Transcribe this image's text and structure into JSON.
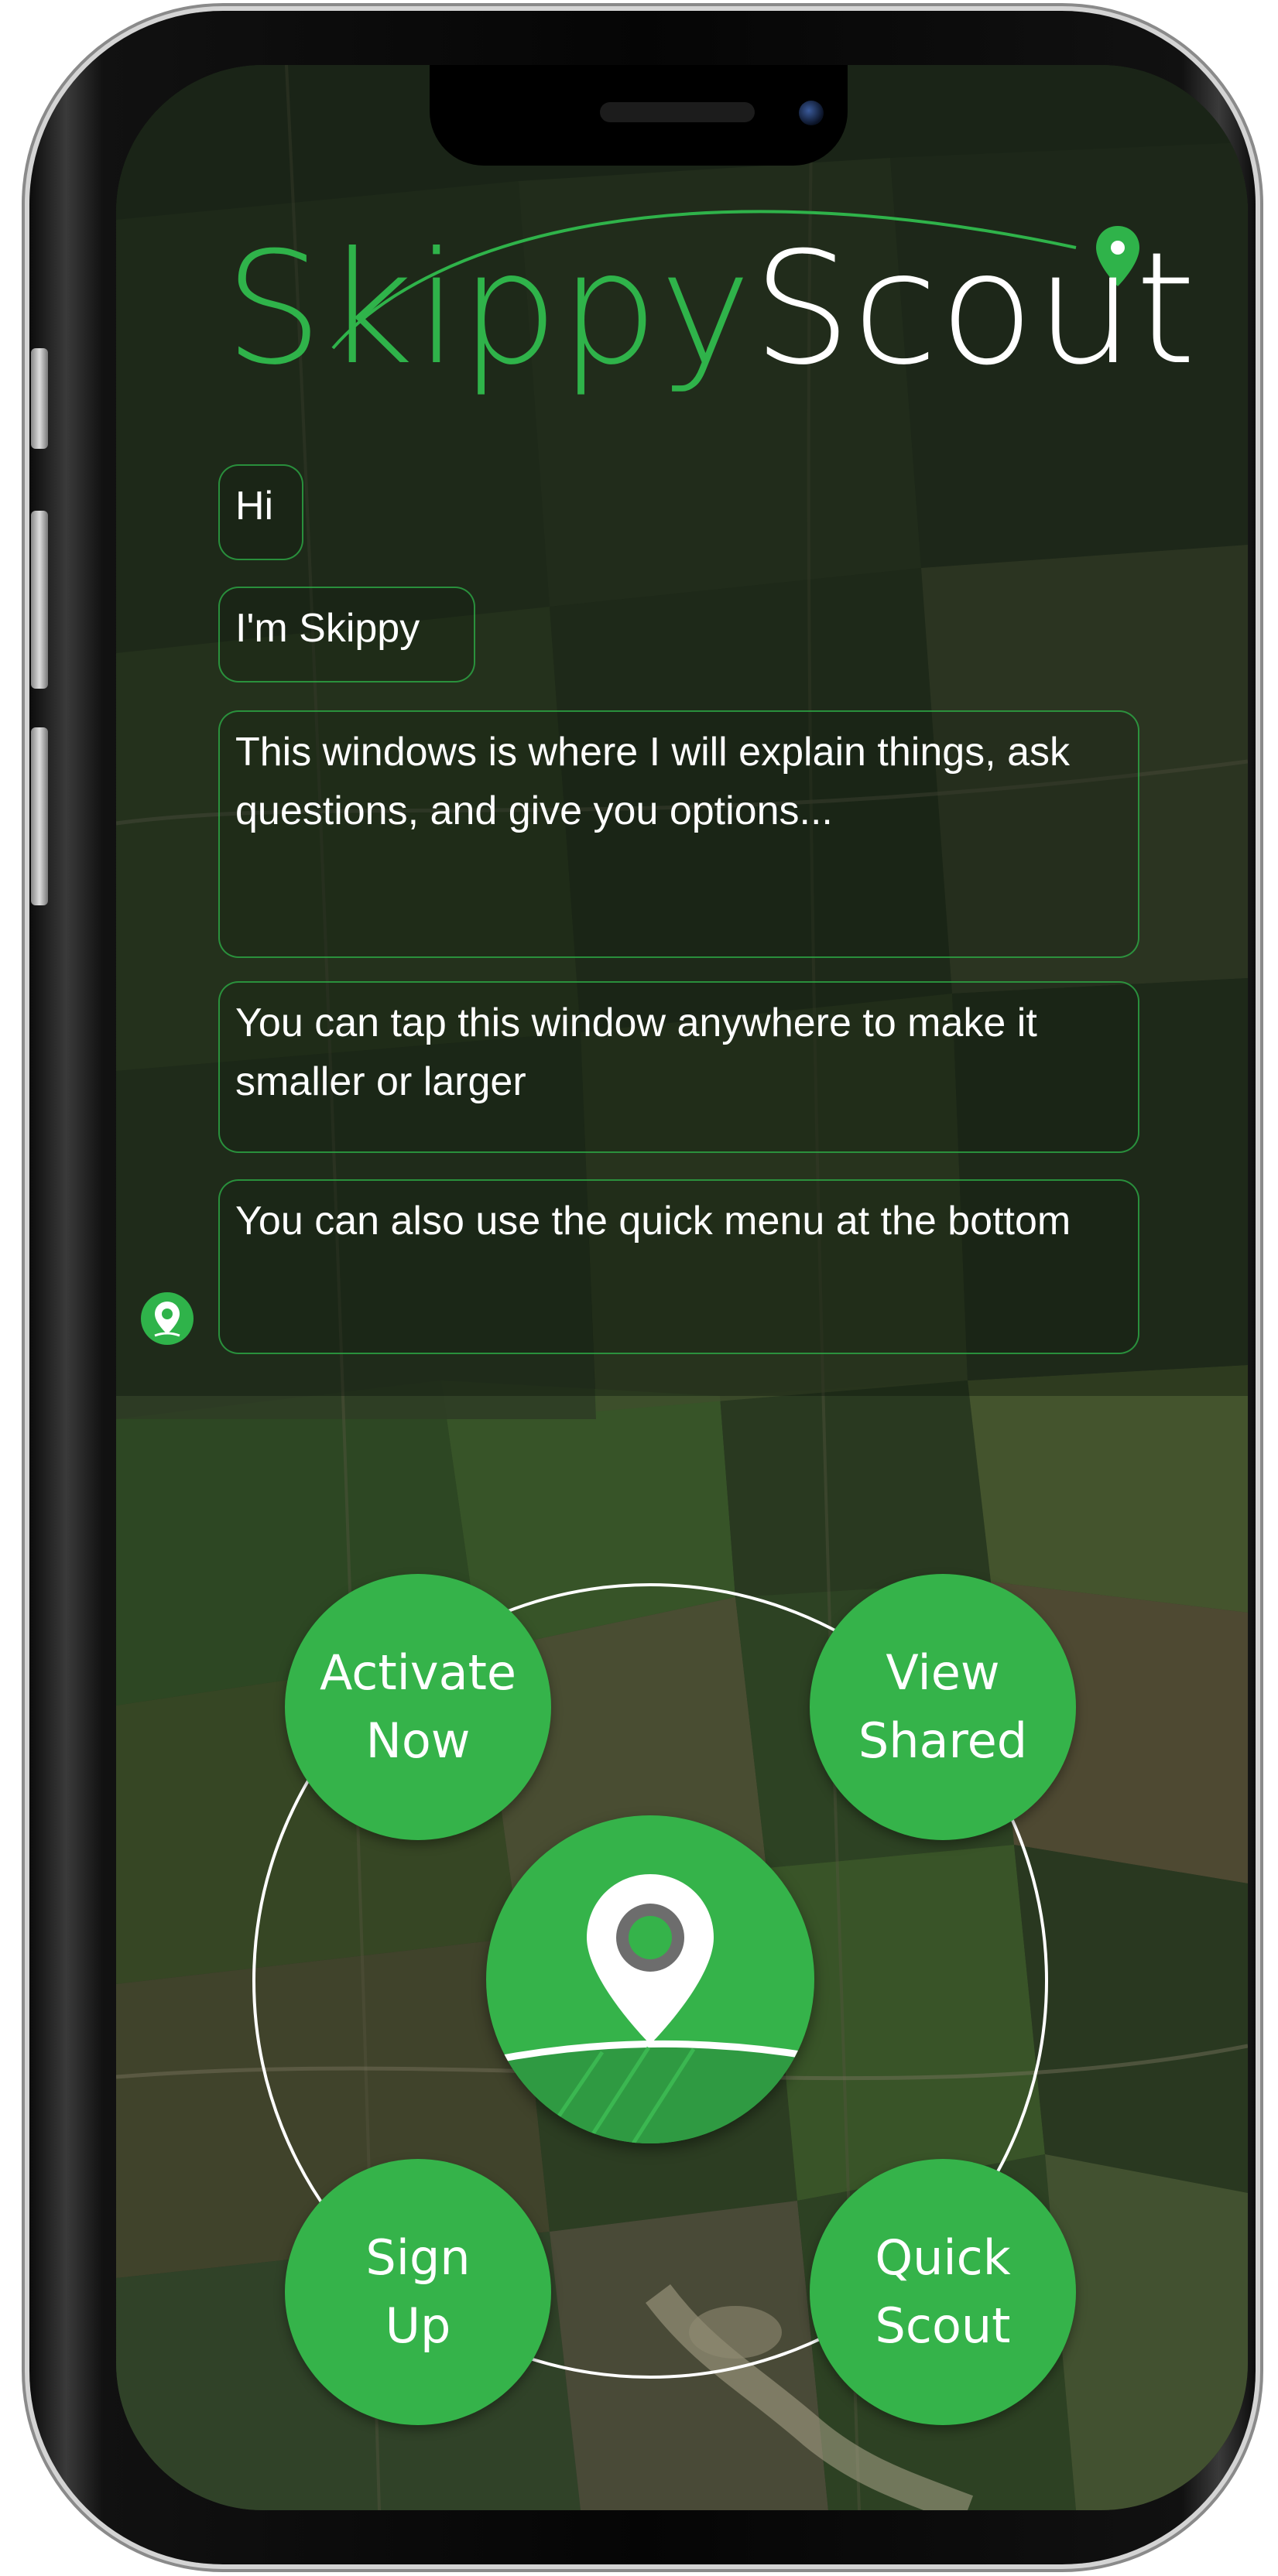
{
  "app": {
    "logo_part1": "Skippy",
    "logo_part2": "Scout"
  },
  "chat": {
    "messages": [
      "Hi",
      "I'm Skippy",
      "This windows is where I will explain things, ask questions, and give you options...",
      "You can tap this window anywhere to make it smaller or larger",
      "You can also use the quick menu at the bottom"
    ],
    "avatar_icon": "location-pin-icon"
  },
  "quick_menu": {
    "activate_line1": "Activate",
    "activate_line2": "Now",
    "view_line1": "View",
    "view_line2": "Shared",
    "signup_line1": "Sign",
    "signup_line2": "Up",
    "quick_line1": "Quick",
    "quick_line2": "Scout",
    "center_icon": "location-pin-field-icon"
  },
  "colors": {
    "brand_green": "#35b34a",
    "logo_green": "#2fb34a",
    "text_white": "#ffffff"
  }
}
